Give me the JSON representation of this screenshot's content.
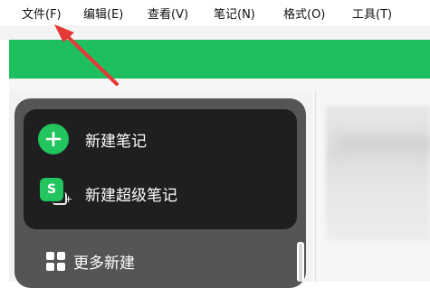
{
  "menubar": {
    "items": [
      "文件(F)",
      "编辑(E)",
      "查看(V)",
      "笔记(N)",
      "格式(O)",
      "工具(T)"
    ]
  },
  "popup": {
    "new_note": "新建笔记",
    "new_super_note": "新建超级笔记",
    "more_new": "更多新建",
    "s_icon_letter": "S",
    "plus_glyph": "+"
  },
  "colors": {
    "green": "#1fbf5f",
    "popup_outer": "#555555",
    "popup_inner": "#1f1f1f",
    "arrow": "#e53935"
  },
  "icons": [
    "plus-circle-icon",
    "super-note-icon",
    "grid-icon",
    "red-arrow-icon"
  ]
}
